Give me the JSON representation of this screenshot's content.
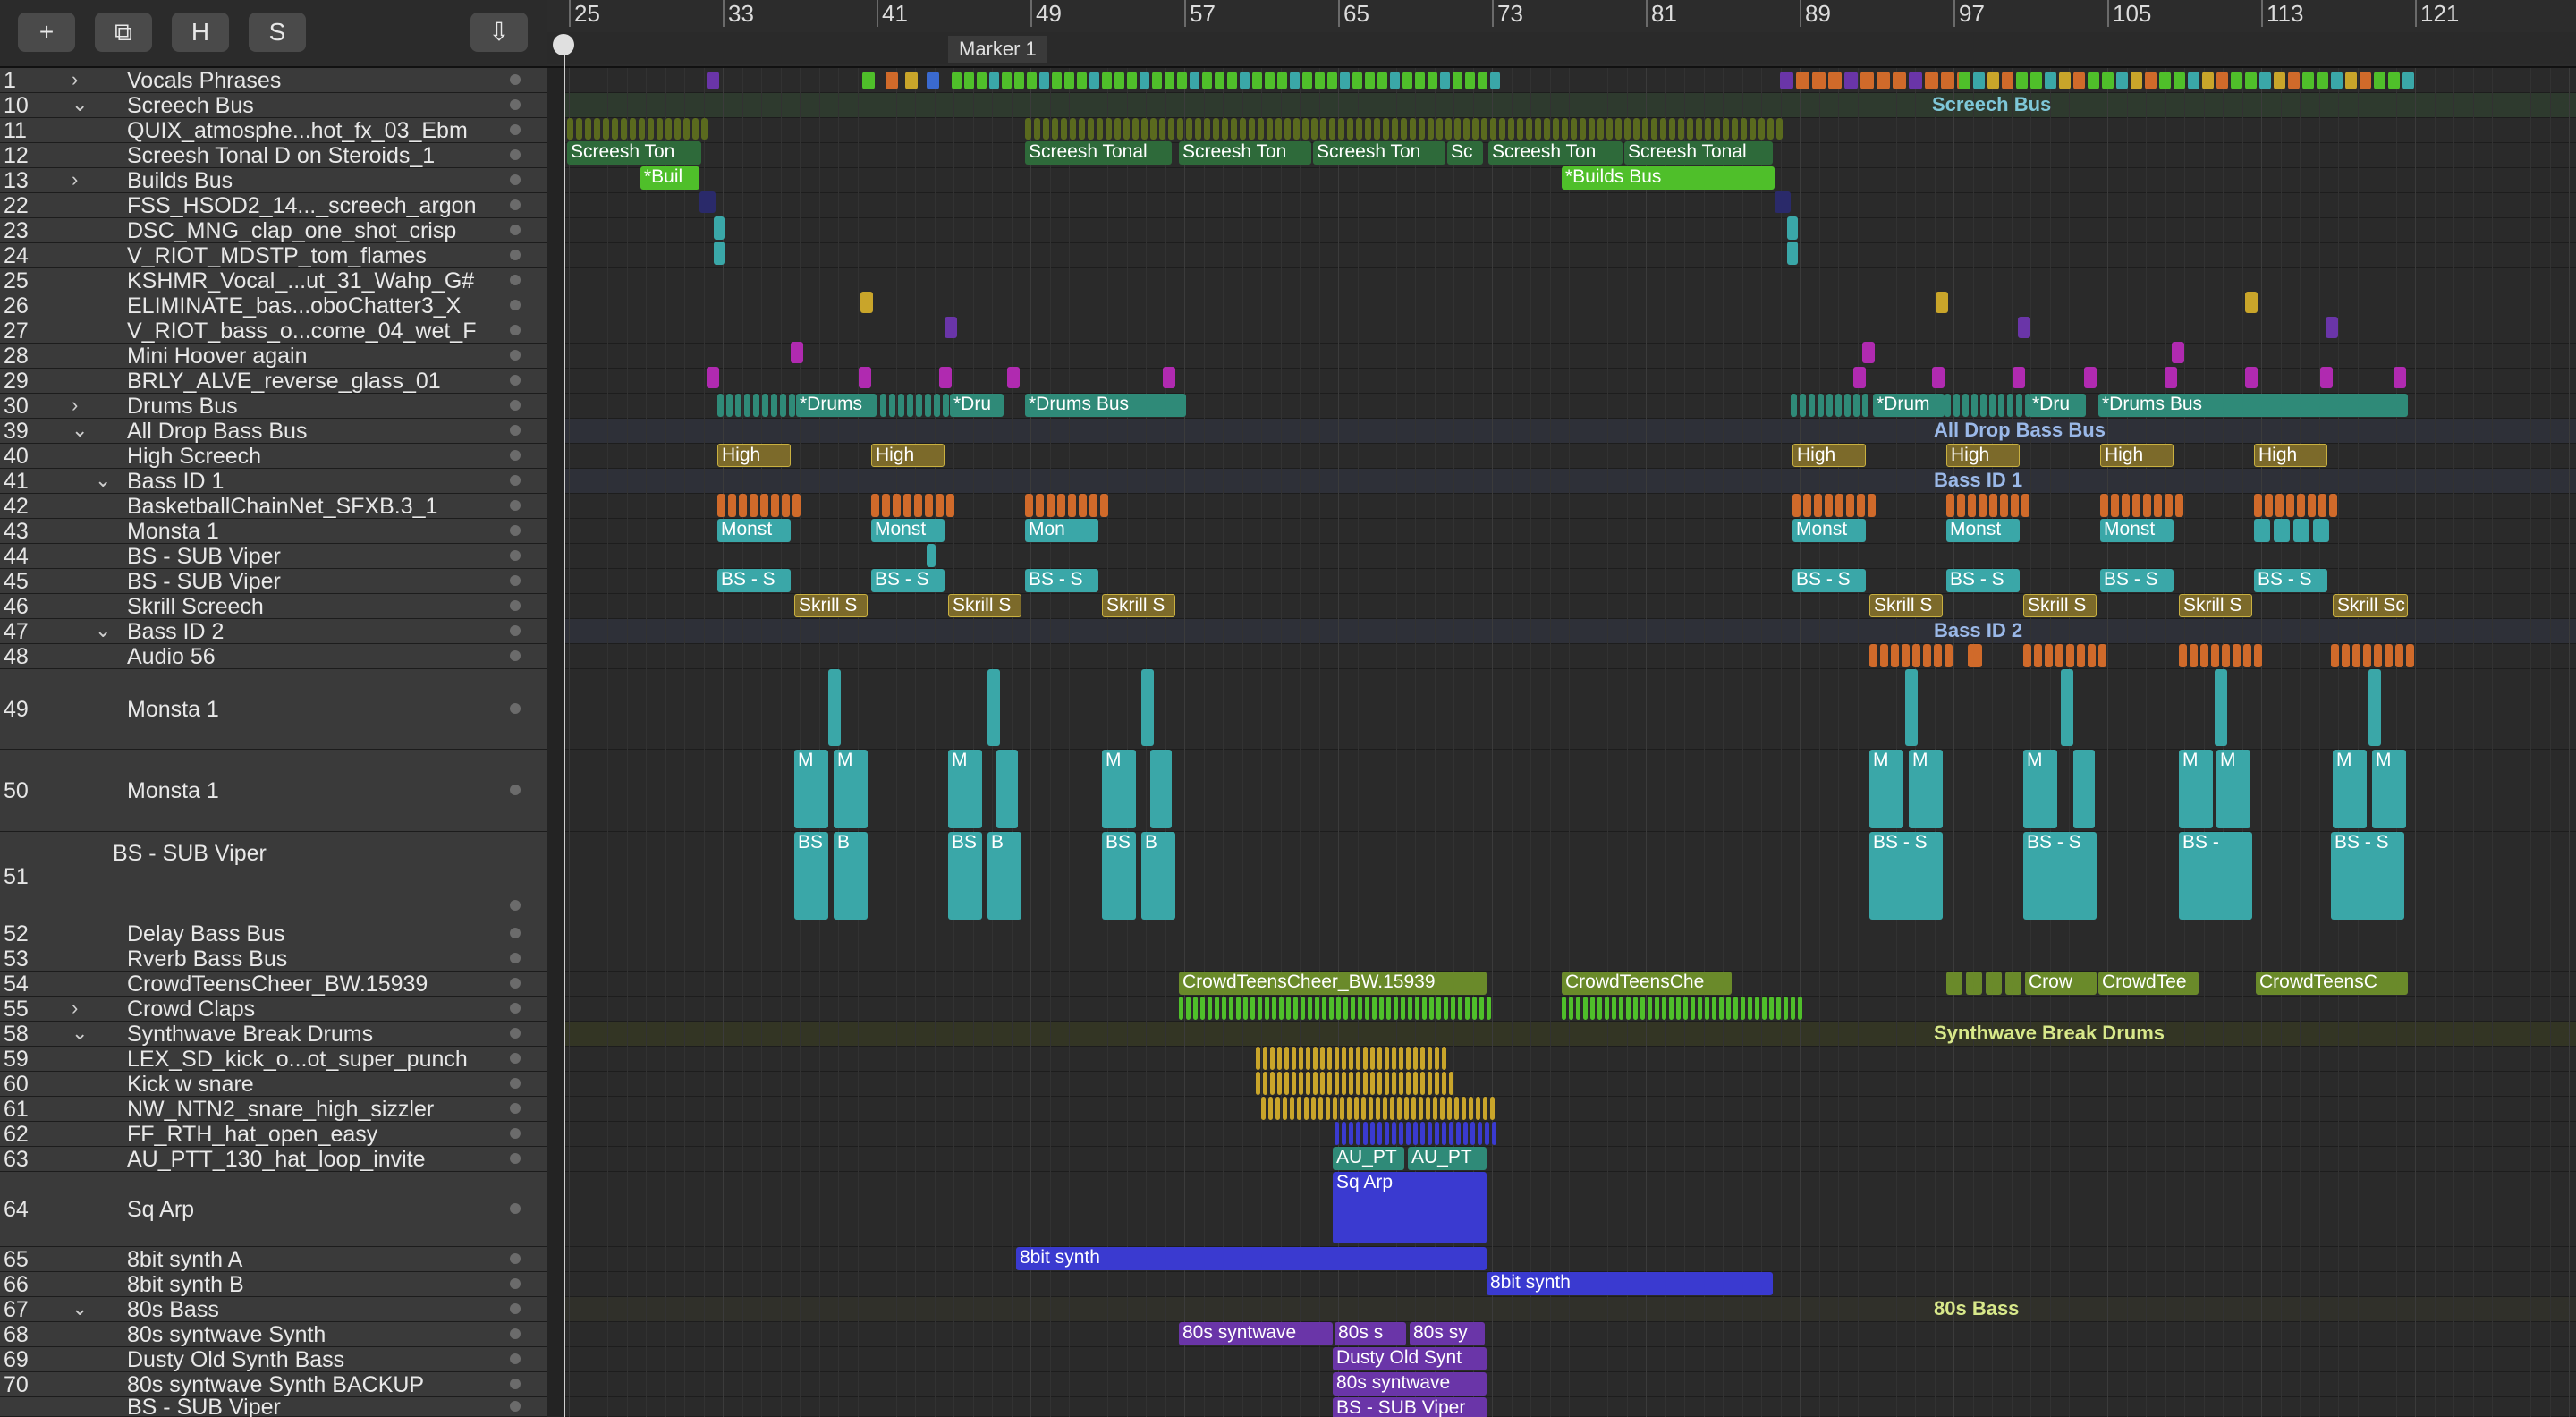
{
  "toolbar": {
    "add_label": "+",
    "duplicate_label": "⧉",
    "h_label": "H",
    "s_label": "S",
    "download_label": "⇩"
  },
  "ruler": {
    "bars": [
      "25",
      "33",
      "41",
      "49",
      "57",
      "65",
      "73",
      "81",
      "89",
      "97",
      "105",
      "113",
      "121"
    ],
    "marker": "Marker 1"
  },
  "tracks": [
    {
      "num": "1",
      "name": "Vocals Phrases",
      "disclosure": "›"
    },
    {
      "num": "10",
      "name": "Screech Bus",
      "disclosure": "⌄"
    },
    {
      "num": "11",
      "name": "QUIX_atmosphe...hot_fx_03_Ebm",
      "disclosure": ""
    },
    {
      "num": "12",
      "name": "Screesh Tonal D on Steroids_1",
      "disclosure": ""
    },
    {
      "num": "13",
      "name": "Builds Bus",
      "disclosure": "›"
    },
    {
      "num": "22",
      "name": "FSS_HSOD2_14..._screech_argon",
      "disclosure": ""
    },
    {
      "num": "23",
      "name": "DSC_MNG_clap_one_shot_crisp",
      "disclosure": ""
    },
    {
      "num": "24",
      "name": "V_RIOT_MDSTP_tom_flames",
      "disclosure": ""
    },
    {
      "num": "25",
      "name": "KSHMR_Vocal_...ut_31_Wahp_G#",
      "disclosure": ""
    },
    {
      "num": "26",
      "name": "ELIMINATE_bas...oboChatter3_X",
      "disclosure": ""
    },
    {
      "num": "27",
      "name": "V_RIOT_bass_o...come_04_wet_F",
      "disclosure": ""
    },
    {
      "num": "28",
      "name": "Mini Hoover again",
      "disclosure": ""
    },
    {
      "num": "29",
      "name": "BRLY_ALVE_reverse_glass_01",
      "disclosure": ""
    },
    {
      "num": "30",
      "name": "Drums Bus",
      "disclosure": "›"
    },
    {
      "num": "39",
      "name": "All Drop Bass Bus",
      "disclosure": "⌄"
    },
    {
      "num": "40",
      "name": "High Screech",
      "disclosure": ""
    },
    {
      "num": "41",
      "name": "Bass ID 1",
      "disclosure": "⌄"
    },
    {
      "num": "42",
      "name": "BasketballChainNet_SFXB.3_1",
      "disclosure": ""
    },
    {
      "num": "43",
      "name": "Monsta 1",
      "disclosure": ""
    },
    {
      "num": "44",
      "name": "BS - SUB Viper",
      "disclosure": ""
    },
    {
      "num": "45",
      "name": "BS - SUB Viper",
      "disclosure": ""
    },
    {
      "num": "46",
      "name": "Skrill Screech",
      "disclosure": ""
    },
    {
      "num": "47",
      "name": "Bass ID 2",
      "disclosure": "⌄"
    },
    {
      "num": "48",
      "name": "Audio 56",
      "disclosure": ""
    },
    {
      "num": "49",
      "name": "Monsta 1",
      "disclosure": ""
    },
    {
      "num": "50",
      "name": "Monsta 1",
      "disclosure": ""
    },
    {
      "num": "51",
      "name": "BS - SUB Viper",
      "disclosure": ""
    },
    {
      "num": "52",
      "name": "Delay Bass Bus",
      "disclosure": ""
    },
    {
      "num": "53",
      "name": "Rverb Bass Bus",
      "disclosure": ""
    },
    {
      "num": "54",
      "name": "CrowdTeensCheer_BW.15939",
      "disclosure": ""
    },
    {
      "num": "55",
      "name": "Crowd Claps",
      "disclosure": "›"
    },
    {
      "num": "58",
      "name": "Synthwave Break Drums",
      "disclosure": "⌄"
    },
    {
      "num": "59",
      "name": "LEX_SD_kick_o...ot_super_punch",
      "disclosure": ""
    },
    {
      "num": "60",
      "name": "Kick w snare",
      "disclosure": ""
    },
    {
      "num": "61",
      "name": "NW_NTN2_snare_high_sizzler",
      "disclosure": ""
    },
    {
      "num": "62",
      "name": "FF_RTH_hat_open_easy",
      "disclosure": ""
    },
    {
      "num": "63",
      "name": "AU_PTT_130_hat_loop_invite",
      "disclosure": ""
    },
    {
      "num": "64",
      "name": "Sq Arp",
      "disclosure": ""
    },
    {
      "num": "65",
      "name": "8bit synth A",
      "disclosure": ""
    },
    {
      "num": "66",
      "name": "8bit synth B",
      "disclosure": ""
    },
    {
      "num": "67",
      "name": "80s Bass",
      "disclosure": "⌄"
    },
    {
      "num": "68",
      "name": "80s syntwave Synth",
      "disclosure": ""
    },
    {
      "num": "69",
      "name": "Dusty Old Synth Bass",
      "disclosure": ""
    },
    {
      "num": "70",
      "name": "80s syntwave Synth BACKUP",
      "disclosure": ""
    },
    {
      "num": "",
      "name": "BS - SUB Viper",
      "disclosure": ""
    }
  ],
  "folder_labels": {
    "screech_bus": "Screech Bus",
    "all_drop_bass_bus": "All Drop Bass Bus",
    "bass_id_1": "Bass ID 1",
    "bass_id_2": "Bass ID 2",
    "synthwave": "Synthwave Break Drums",
    "bass80s": "80s Bass"
  },
  "regions": {
    "screesh_ton": "Screesh Ton",
    "screesh_tonal": "Screesh Tonal",
    "sc": "Sc",
    "bui": "*Buil",
    "builds_bus": "*Builds Bus",
    "drums": "*Drums",
    "dru": "*Dru",
    "drums_bus": "*Drums Bus",
    "drum": "*Drum",
    "high": "High",
    "monst": "Monst",
    "mon": "Mon",
    "bs_s": "BS - S",
    "bs_dash": "BS -",
    "bs": "BS",
    "b": "B",
    "m": "M",
    "skrill_s": "Skrill S",
    "skrill_sc": "Skrill Sc",
    "crowd_full": "CrowdTeensCheer_BW.15939",
    "crowd_che": "CrowdTeensChe",
    "crow": "Crow",
    "crowd_tee": "CrowdTee",
    "crowd_c": "CrowdTeensC",
    "au_pt": "AU_PT",
    "sq_arp": "Sq Arp",
    "bit8": "8bit synth",
    "s80_syntwave": "80s syntwave",
    "s80_s": "80s s",
    "s80_sy": "80s sy",
    "dusty": "Dusty Old Synt",
    "s80_syntwave2": "80s syntwave",
    "bs_sub_viper": "BS - SUB Viper"
  },
  "colors": {
    "purple": "#8a3fcf",
    "green": "#4fbf2a",
    "teal": "#3aa7a8",
    "orange": "#d06a2a",
    "olive": "#7c6a2a",
    "drums": "#2f8a78",
    "yellow": "#c9a52a",
    "blue": "#3a3ad0",
    "violet": "#6a35a8",
    "crowd": "#6a8a2a",
    "screech_green": "#2e6a3a"
  }
}
